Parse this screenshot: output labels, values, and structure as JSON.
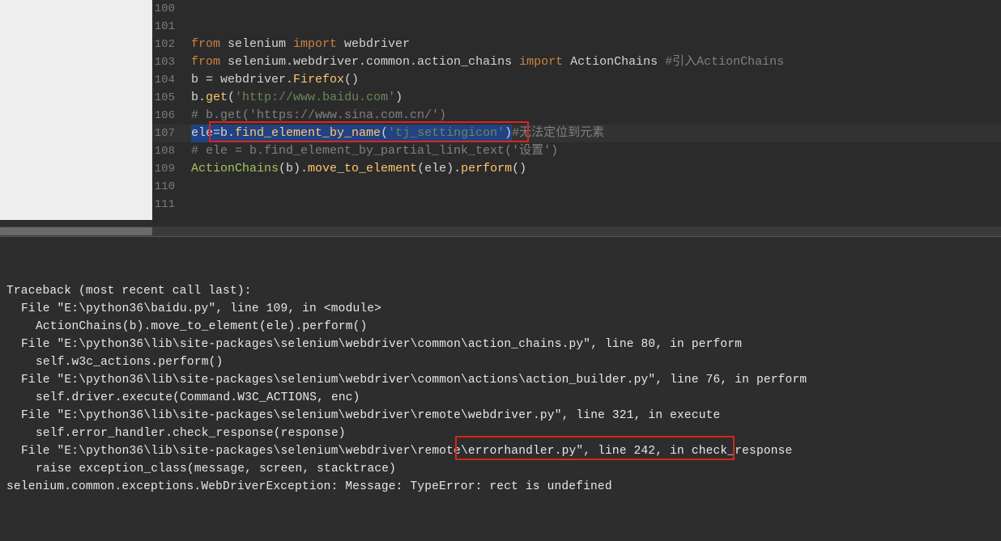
{
  "editor": {
    "lines": [
      {
        "num": "100",
        "tokens": []
      },
      {
        "num": "101",
        "tokens": []
      },
      {
        "num": "102",
        "tokens": [
          {
            "cls": "kw",
            "t": "from "
          },
          {
            "cls": "pl",
            "t": "selenium "
          },
          {
            "cls": "kw",
            "t": "import "
          },
          {
            "cls": "pl",
            "t": "webdriver"
          }
        ]
      },
      {
        "num": "103",
        "tokens": [
          {
            "cls": "kw",
            "t": "from "
          },
          {
            "cls": "pl",
            "t": "selenium.webdriver.common.action_chains "
          },
          {
            "cls": "kw",
            "t": "import "
          },
          {
            "cls": "pl",
            "t": "ActionChains "
          },
          {
            "cls": "cmt",
            "t": "#引入ActionChains"
          }
        ]
      },
      {
        "num": "104",
        "tokens": [
          {
            "cls": "pl",
            "t": "b = webdriver."
          },
          {
            "cls": "fn",
            "t": "Firefox"
          },
          {
            "cls": "pl",
            "t": "()"
          }
        ]
      },
      {
        "num": "105",
        "tokens": [
          {
            "cls": "pl",
            "t": "b."
          },
          {
            "cls": "fn",
            "t": "get"
          },
          {
            "cls": "pl",
            "t": "("
          },
          {
            "cls": "str",
            "t": "'http://www.baidu.com'"
          },
          {
            "cls": "pl",
            "t": ")"
          }
        ]
      },
      {
        "num": "106",
        "tokens": [
          {
            "cls": "cmt",
            "t": "# b.get('https://www.sina.com.cn/')"
          }
        ]
      },
      {
        "num": "107",
        "highlighted": true,
        "tokens": [
          {
            "cls": "pl",
            "t": "ele",
            "sel": true
          },
          {
            "cls": "pl",
            "t": "=b.",
            "sel": true
          },
          {
            "cls": "fn",
            "t": "find_element_by_name",
            "sel": true
          },
          {
            "cls": "pl",
            "t": "(",
            "sel": true
          },
          {
            "cls": "str",
            "t": "'tj_settingicon'",
            "sel": true
          },
          {
            "cls": "pl",
            "t": ")",
            "sel": true
          },
          {
            "cls": "cmt",
            "t": "#无法定位到元素"
          }
        ]
      },
      {
        "num": "108",
        "tokens": [
          {
            "cls": "cmt",
            "t": "# ele = b.find_element_by_partial_link_text('设置')"
          }
        ]
      },
      {
        "num": "109",
        "tokens": [
          {
            "cls": "cls",
            "t": "ActionChains"
          },
          {
            "cls": "pl",
            "t": "(b)."
          },
          {
            "cls": "fn",
            "t": "move_to_element"
          },
          {
            "cls": "pl",
            "t": "(ele)."
          },
          {
            "cls": "fn",
            "t": "perform"
          },
          {
            "cls": "pl",
            "t": "()"
          }
        ]
      },
      {
        "num": "110",
        "tokens": []
      },
      {
        "num": "111",
        "tokens": []
      }
    ]
  },
  "terminal": {
    "lines": [
      {
        "indent": 0,
        "t": "Traceback (most recent call last):"
      },
      {
        "indent": 1,
        "t": "File \"E:\\python36\\baidu.py\", line 109, in <module>"
      },
      {
        "indent": 2,
        "t": "ActionChains(b).move_to_element(ele).perform()"
      },
      {
        "indent": 1,
        "t": "File \"E:\\python36\\lib\\site-packages\\selenium\\webdriver\\common\\action_chains.py\", line 80, in perform"
      },
      {
        "indent": 2,
        "t": "self.w3c_actions.perform()"
      },
      {
        "indent": 1,
        "t": "File \"E:\\python36\\lib\\site-packages\\selenium\\webdriver\\common\\actions\\action_builder.py\", line 76, in perform"
      },
      {
        "indent": 2,
        "t": "self.driver.execute(Command.W3C_ACTIONS, enc)"
      },
      {
        "indent": 1,
        "t": "File \"E:\\python36\\lib\\site-packages\\selenium\\webdriver\\remote\\webdriver.py\", line 321, in execute"
      },
      {
        "indent": 2,
        "t": "self.error_handler.check_response(response)"
      },
      {
        "indent": 1,
        "t": "File \"E:\\python36\\lib\\site-packages\\selenium\\webdriver\\remote\\errorhandler.py\", line 242, in check_response"
      },
      {
        "indent": 2,
        "t": "raise exception_class(message, screen, stacktrace)"
      },
      {
        "indent": 0,
        "t": "selenium.common.exceptions.WebDriverException: Message: TypeError: rect is undefined"
      }
    ]
  },
  "highlights": {
    "editor_box_text": "ele=b.find_element_by_name('tj_settingicon')#无法定位到元素",
    "terminal_box_text": "TypeError: rect is undefined"
  }
}
